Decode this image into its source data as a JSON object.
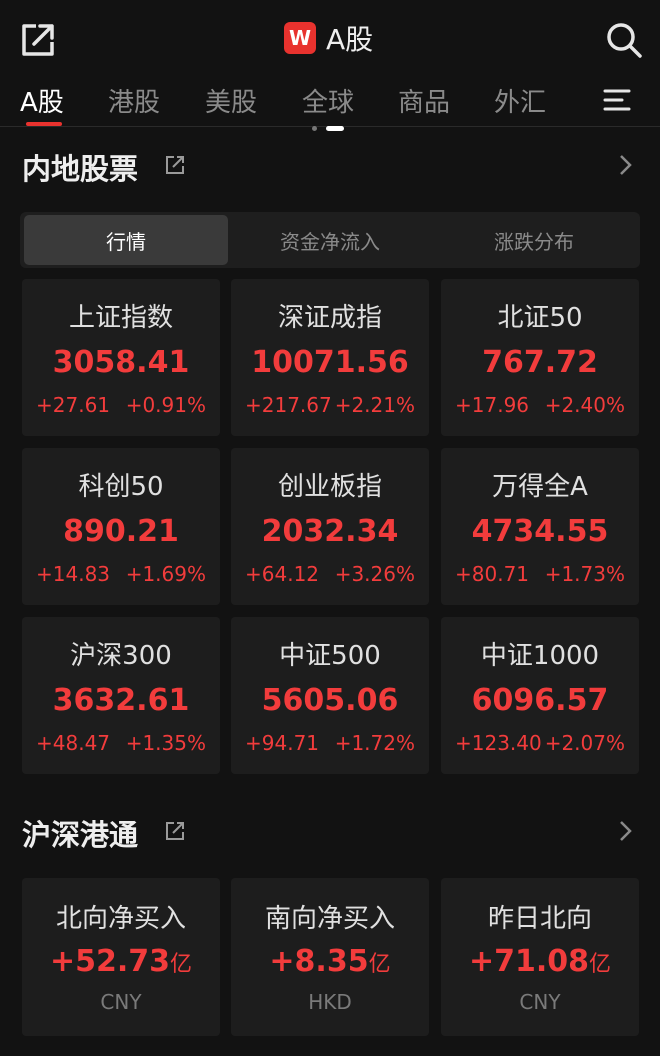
{
  "header": {
    "brand_letter": "W",
    "title": "A股",
    "icons": {
      "share": "share-external-icon",
      "search": "search-icon",
      "menu": "menu-lines-icon"
    }
  },
  "tabs": [
    {
      "label": "A股",
      "active": true
    },
    {
      "label": "港股",
      "active": false
    },
    {
      "label": "美股",
      "active": false
    },
    {
      "label": "全球",
      "active": false
    },
    {
      "label": "商品",
      "active": false
    },
    {
      "label": "外汇",
      "active": false
    }
  ],
  "section_mainland": {
    "title": "内地股票",
    "segments": [
      {
        "label": "行情",
        "active": true
      },
      {
        "label": "资金净流入",
        "active": false
      },
      {
        "label": "涨跌分布",
        "active": false
      }
    ],
    "indices": [
      {
        "name": "上证指数",
        "price": "3058.41",
        "change": "+27.61",
        "pct": "+0.91%"
      },
      {
        "name": "深证成指",
        "price": "10071.56",
        "change": "+217.67",
        "pct": "+2.21%"
      },
      {
        "name": "北证50",
        "price": "767.72",
        "change": "+17.96",
        "pct": "+2.40%"
      },
      {
        "name": "科创50",
        "price": "890.21",
        "change": "+14.83",
        "pct": "+1.69%"
      },
      {
        "name": "创业板指",
        "price": "2032.34",
        "change": "+64.12",
        "pct": "+3.26%"
      },
      {
        "name": "万得全A",
        "price": "4734.55",
        "change": "+80.71",
        "pct": "+1.73%"
      },
      {
        "name": "沪深300",
        "price": "3632.61",
        "change": "+48.47",
        "pct": "+1.35%"
      },
      {
        "name": "中证500",
        "price": "5605.06",
        "change": "+94.71",
        "pct": "+1.72%"
      },
      {
        "name": "中证1000",
        "price": "6096.57",
        "change": "+123.40",
        "pct": "+2.07%"
      }
    ]
  },
  "section_connect": {
    "title": "沪深港通",
    "flows": [
      {
        "name": "北向净买入",
        "value": "+52.73",
        "unit": "亿",
        "currency": "CNY"
      },
      {
        "name": "南向净买入",
        "value": "+8.35",
        "unit": "亿",
        "currency": "HKD"
      },
      {
        "name": "昨日北向",
        "value": "+71.08",
        "unit": "亿",
        "currency": "CNY"
      }
    ]
  },
  "colors": {
    "up": "#f23c3c",
    "accent": "#e8322e",
    "background": "#121212",
    "card": "#1d1d1d"
  }
}
